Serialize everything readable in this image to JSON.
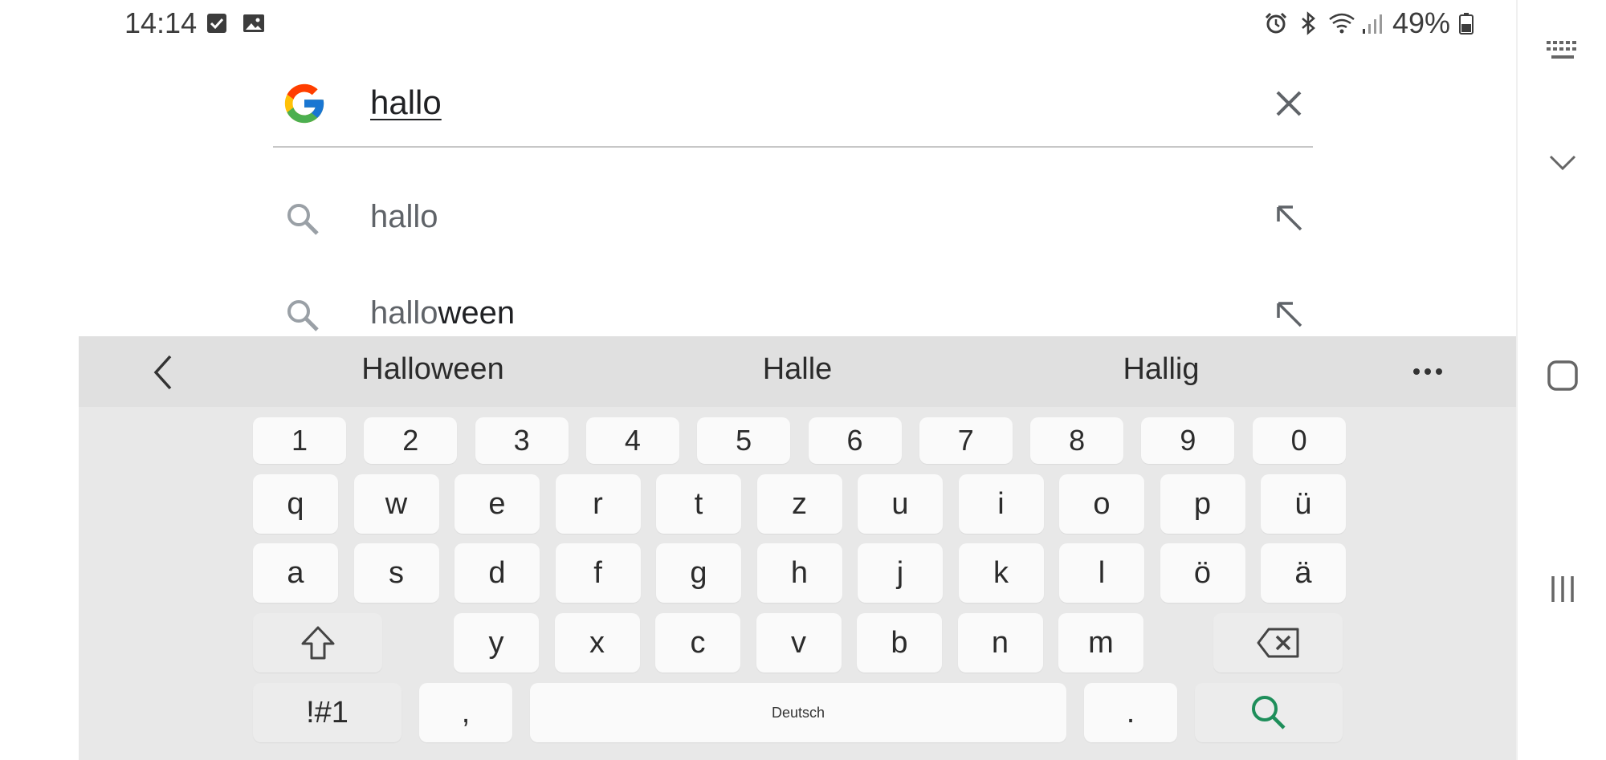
{
  "status_bar": {
    "time": "14:14",
    "battery_percent": "49%",
    "left_icons": [
      "checkbox-icon",
      "image-icon"
    ],
    "right_icons": [
      "alarm-icon",
      "bluetooth-icon",
      "wifi-icon",
      "signal-icon",
      "battery-icon"
    ]
  },
  "search": {
    "query": "hallo",
    "clear_icon": "close-icon",
    "logo": "google-g-logo"
  },
  "suggestions": [
    {
      "prefix": "hallo",
      "rest": "",
      "icon": "search-icon",
      "action_icon": "arrow-up-left-icon"
    },
    {
      "prefix": "hallo",
      "rest": "ween",
      "icon": "search-icon",
      "action_icon": "arrow-up-left-icon"
    }
  ],
  "keyboard": {
    "predictions": [
      "Halloween",
      "Halle",
      "Hallig"
    ],
    "number_row": [
      "1",
      "2",
      "3",
      "4",
      "5",
      "6",
      "7",
      "8",
      "9",
      "0"
    ],
    "row1": [
      "q",
      "w",
      "e",
      "r",
      "t",
      "z",
      "u",
      "i",
      "o",
      "p",
      "ü"
    ],
    "row2": [
      "a",
      "s",
      "d",
      "f",
      "g",
      "h",
      "j",
      "k",
      "l",
      "ö",
      "ä"
    ],
    "row3": [
      "y",
      "x",
      "c",
      "v",
      "b",
      "n",
      "m"
    ],
    "symbols_label": "!#1",
    "comma_label": ",",
    "space_label": "Deutsch",
    "period_label": ".",
    "accent_color": "#1e8e5a"
  },
  "nav_bar": {
    "buttons": [
      "keyboard-icon",
      "chevron-down-icon",
      "home-square-icon",
      "recents-icon"
    ]
  }
}
